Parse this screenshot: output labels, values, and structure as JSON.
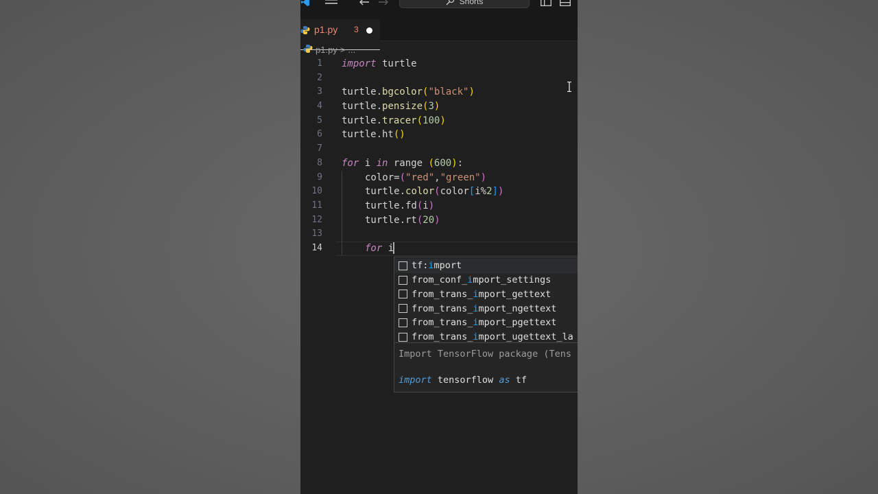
{
  "titlebar": {
    "search_label": "Shorts"
  },
  "tab": {
    "filename": "p1.py",
    "problem_count": "3",
    "dirty": true
  },
  "breadcrumb": {
    "file": "p1.py",
    "separator": ">",
    "rest": "..."
  },
  "editor": {
    "lines": [
      {
        "n": "1",
        "tokens": [
          [
            "kw",
            "import"
          ],
          [
            "t",
            " turtle"
          ]
        ]
      },
      {
        "n": "2",
        "tokens": []
      },
      {
        "n": "3",
        "tokens": [
          [
            "t",
            "turtle."
          ],
          [
            "fn",
            "bgcolor"
          ],
          [
            "pl",
            "("
          ],
          [
            "str",
            "\"black\""
          ],
          [
            "pl",
            ")"
          ]
        ]
      },
      {
        "n": "4",
        "tokens": [
          [
            "t",
            "turtle."
          ],
          [
            "fn",
            "pensize"
          ],
          [
            "pl",
            "("
          ],
          [
            "num",
            "3"
          ],
          [
            "pl",
            ")"
          ]
        ]
      },
      {
        "n": "5",
        "tokens": [
          [
            "t",
            "turtle."
          ],
          [
            "fn",
            "tracer"
          ],
          [
            "pl",
            "("
          ],
          [
            "num",
            "100"
          ],
          [
            "pl",
            ")"
          ]
        ]
      },
      {
        "n": "6",
        "tokens": [
          [
            "t",
            "turtle.ht"
          ],
          [
            "pl",
            "()"
          ]
        ]
      },
      {
        "n": "7",
        "tokens": []
      },
      {
        "n": "8",
        "tokens": [
          [
            "kw",
            "for"
          ],
          [
            "t",
            " i "
          ],
          [
            "kw",
            "in"
          ],
          [
            "t",
            " range "
          ],
          [
            "pl",
            "("
          ],
          [
            "num",
            "600"
          ],
          [
            "pl",
            ")"
          ],
          [
            "t",
            ":"
          ]
        ]
      },
      {
        "n": "9",
        "indent": 1,
        "tokens": [
          [
            "t",
            "color="
          ],
          [
            "pb",
            "("
          ],
          [
            "str",
            "\"red\""
          ],
          [
            "t",
            ","
          ],
          [
            "str",
            "\"green\""
          ],
          [
            "pb",
            ")"
          ]
        ]
      },
      {
        "n": "10",
        "indent": 1,
        "tokens": [
          [
            "t",
            "turtle."
          ],
          [
            "fn",
            "color"
          ],
          [
            "pb",
            "("
          ],
          [
            "t",
            "color"
          ],
          [
            "pc",
            "["
          ],
          [
            "t",
            "i%"
          ],
          [
            "num",
            "2"
          ],
          [
            "pc",
            "]"
          ],
          [
            "pb",
            ")"
          ]
        ]
      },
      {
        "n": "11",
        "indent": 1,
        "tokens": [
          [
            "t",
            "turtle.fd"
          ],
          [
            "pb",
            "("
          ],
          [
            "t",
            "i"
          ],
          [
            "pb",
            ")"
          ]
        ]
      },
      {
        "n": "12",
        "indent": 1,
        "tokens": [
          [
            "t",
            "turtle.rt"
          ],
          [
            "pb",
            "("
          ],
          [
            "num",
            "20"
          ],
          [
            "pb",
            ")"
          ]
        ]
      },
      {
        "n": "13",
        "indent": 1,
        "tokens": []
      },
      {
        "n": "14",
        "indent": 1,
        "active": true,
        "tokens": [
          [
            "kw",
            "for"
          ],
          [
            "t",
            " i"
          ]
        ]
      }
    ]
  },
  "suggest": {
    "items": [
      {
        "pre": "tf:",
        "match": "i",
        "post": "mport",
        "selected": true
      },
      {
        "pre": "from_conf_",
        "match": "i",
        "post": "mport_settings"
      },
      {
        "pre": "from_trans_",
        "match": "i",
        "post": "mport_gettext"
      },
      {
        "pre": "from_trans_",
        "match": "i",
        "post": "mport_ngettext"
      },
      {
        "pre": "from_trans_",
        "match": "i",
        "post": "mport_pgettext"
      },
      {
        "pre": "from_trans_",
        "match": "i",
        "post": "mport_ugettext_la"
      }
    ],
    "description": "Import TensorFlow package (Tens",
    "code_keyword_1": "import",
    "code_name": " tensorflow ",
    "code_keyword_2": "as",
    "code_alias": " tf"
  },
  "colors": {
    "background": "#5e5e5e",
    "editor_bg": "#1f1f1f",
    "tab_error": "#f48771",
    "keyword": "#c586c0",
    "function": "#dcdcaa",
    "string": "#ce9178",
    "number": "#b5cea8",
    "match": "#18a3ff"
  }
}
